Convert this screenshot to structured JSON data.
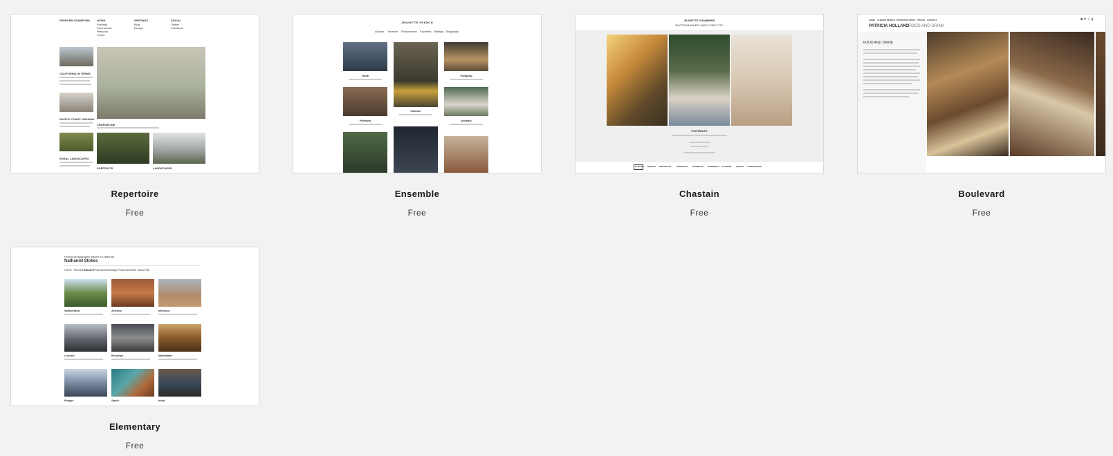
{
  "templates": [
    {
      "name": "Repertoire",
      "price": "Free",
      "preview": {
        "site_name": "SPENCER CRAWFORD",
        "nav_cols": [
          {
            "head": "WORK",
            "items": [
              "Portraits",
              "Commercial",
              "Personal",
              "Travel"
            ]
          },
          {
            "head": "WRITINGS",
            "items": [
              "Blog",
              "Essays"
            ]
          },
          {
            "head": "SOCIAL",
            "items": [
              "Twitter",
              "Facebook"
            ]
          }
        ],
        "posts": [
          "CALIFORNIA IN TERMS",
          "PACIFIC COAST HIGHWAY",
          "RURAL LANDSCAPES"
        ],
        "feature_caption": "CHARGELINE",
        "labels": [
          "PORTRAITS",
          "LANDSCAPES"
        ]
      }
    },
    {
      "name": "Ensemble",
      "price": "Free",
      "preview": {
        "site_name": "JEANETTE FRENCH",
        "nav": [
          "Albums",
          "Timeline",
          "Photostream",
          "Favorites",
          "Writings",
          "Biography"
        ],
        "captions": [
          "Youth",
          "Pumping",
          "Fashion",
          "Portraits",
          "Animals"
        ]
      }
    },
    {
      "name": "Chastain",
      "price": "Free",
      "preview": {
        "site_name": "JEANETTE CHAMBERS",
        "tagline": "PHOTOGRAPHER / NEW YORK CITY",
        "section": "PORTRAITS",
        "nav": [
          "ALBUMS",
          "DESIGN",
          "PORTRAITS",
          "PERSONAL",
          "FAVORITES",
          "WEDDINGS",
          "FASHION",
          "TRAVEL",
          "LANDSCAPES"
        ]
      }
    },
    {
      "name": "Boulevard",
      "price": "Free",
      "preview": {
        "brand": "PATRICIA HOLLAND",
        "brand_sub": "/ FOOD AND DRINK",
        "heading": "FOOD AND DRINK",
        "nav": [
          "HOME",
          "ALBUMS",
          "PEOPLE",
          "PORTRAITS",
          "FOOD",
          "TRAVEL",
          "CONTACT"
        ]
      }
    },
    {
      "name": "Elementary",
      "price": "Free",
      "preview": {
        "kicker": "Portrait photographer based in California",
        "site_name": "Nathaniel Stokes",
        "nav": [
          "Home",
          "Timeline",
          "Albums",
          "Photostream",
          "Design",
          "Personal",
          "Travel",
          "About Me"
        ],
        "captions": [
          "Switzerland",
          "Arizona",
          "Morocco",
          "London",
          "Brooklyn",
          "Manhattan",
          "Prague",
          "Spain",
          "India"
        ]
      }
    }
  ],
  "colors": {
    "background": "#f2f2f2",
    "card_border": "#d9d9d9",
    "accent_red": "#c0392b"
  }
}
